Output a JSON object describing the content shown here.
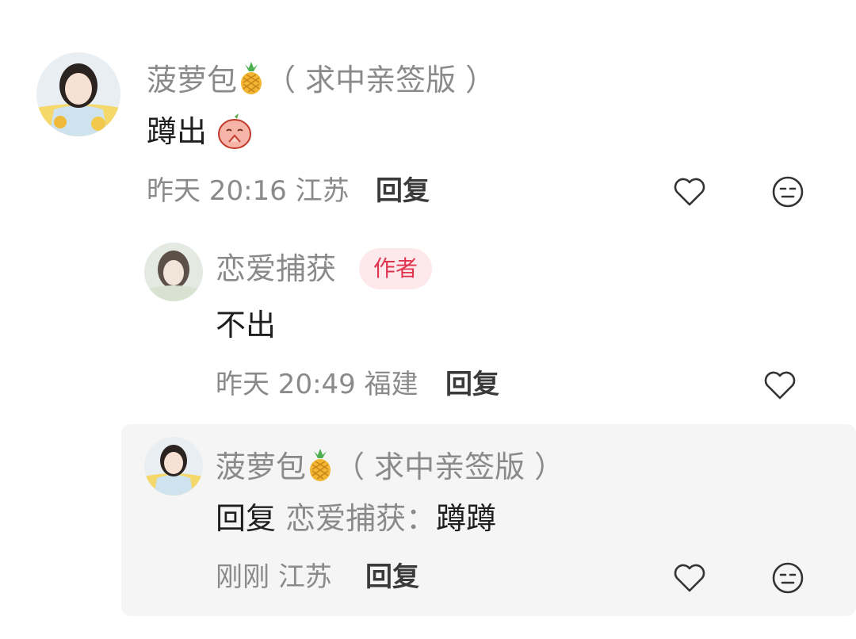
{
  "comments": [
    {
      "author": "菠萝包",
      "author_suffix": "（ 求中亲签版 ）",
      "text": "蹲出",
      "time": "昨天 20:16",
      "location": "江苏",
      "reply_label": "回复"
    },
    {
      "author": "恋爱捕获",
      "badge": "作者",
      "text": "不出",
      "time": "昨天 20:49",
      "location": "福建",
      "reply_label": "回复"
    },
    {
      "author": "菠萝包",
      "author_suffix": "（ 求中亲签版 ）",
      "reply_prefix": "回复",
      "reply_target": "恋爱捕获：",
      "text": "蹲蹲",
      "time": "刚刚",
      "location": "江苏",
      "reply_label": "回复"
    }
  ],
  "icons": {
    "like": "heart-outline-icon",
    "dislike": "meh-face-icon",
    "author_emoji": "pineapple-icon",
    "content_emoji": "peach-pray-sticker"
  },
  "colors": {
    "badge_bg": "#fde9ec",
    "badge_text": "#e0344e",
    "nested_bg": "#f5f5f5"
  }
}
